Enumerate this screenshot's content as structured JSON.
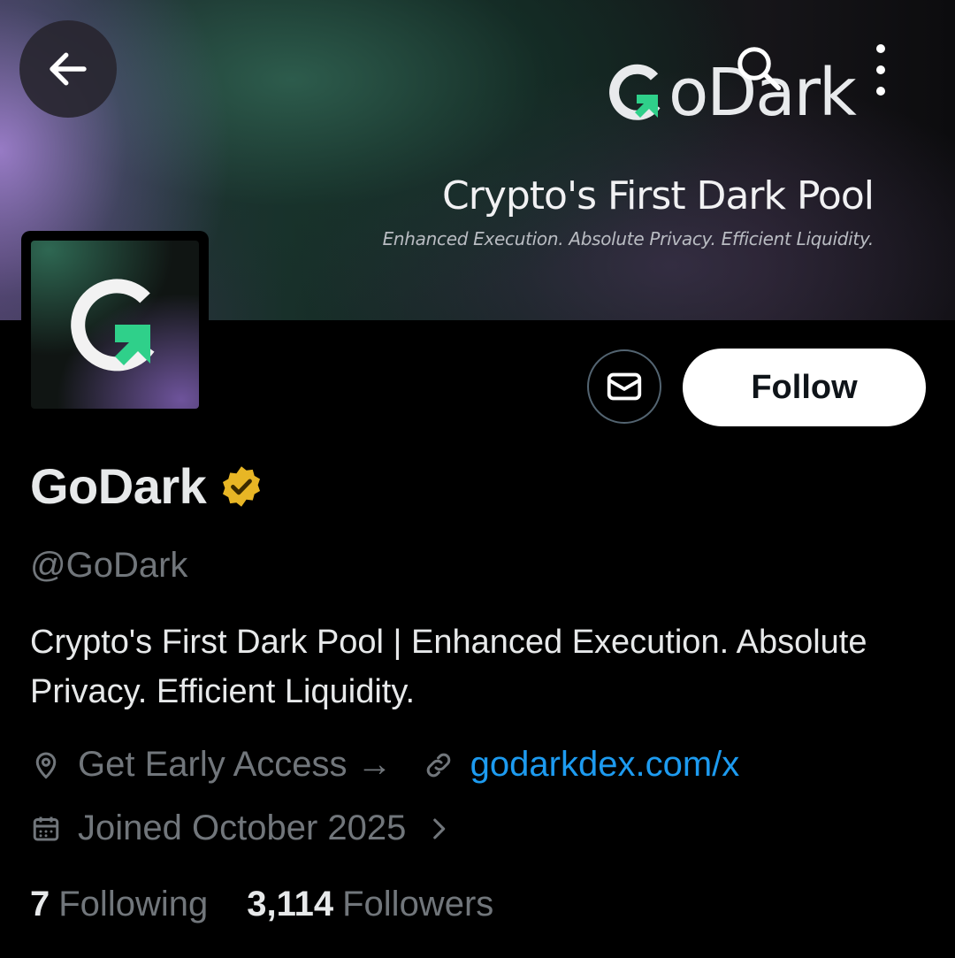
{
  "header": {
    "back_icon": "arrow-left-icon",
    "search_icon": "search-icon",
    "more_icon": "more-vertical-icon"
  },
  "banner": {
    "logo_text": "oDark",
    "tagline": "Crypto's First Dark Pool",
    "subtagline": "Enhanced Execution. Absolute Privacy. Efficient Liquidity."
  },
  "profile": {
    "display_name": "GoDark",
    "handle": "@GoDark",
    "verified_badge_color": "#e8b625",
    "bio": "Crypto's First Dark Pool | Enhanced Execution. Absolute Privacy. Efficient Liquidity.",
    "location_text": "Get Early Access →",
    "website": "godarkdex.com/x",
    "joined": "Joined October 2025",
    "following_count": "7",
    "following_label": "Following",
    "followers_count": "3,114",
    "followers_label": "Followers"
  },
  "actions": {
    "message_icon": "envelope-icon",
    "follow_label": "Follow"
  },
  "colors": {
    "background": "#000000",
    "secondary_text": "#71767b",
    "link": "#1d9bf0",
    "brand_green": "#2fd08a"
  }
}
